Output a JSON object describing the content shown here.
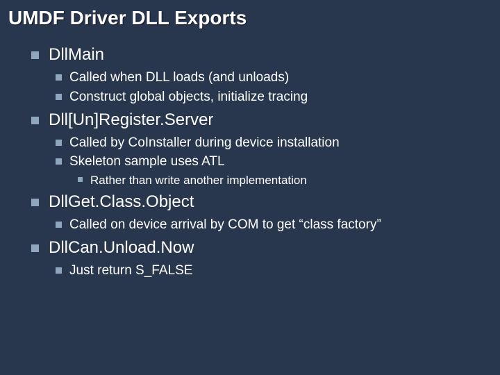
{
  "title": "UMDF Driver DLL Exports",
  "items": [
    {
      "label": "DllMain",
      "children": [
        {
          "label": "Called when DLL loads (and unloads)"
        },
        {
          "label": "Construct global objects, initialize tracing"
        }
      ]
    },
    {
      "label": "Dll[Un]Register.Server",
      "children": [
        {
          "label": "Called by CoInstaller during device installation"
        },
        {
          "label": "Skeleton sample uses ATL",
          "children": [
            {
              "label": "Rather than write another implementation"
            }
          ]
        }
      ]
    },
    {
      "label": "DllGet.Class.Object",
      "children": [
        {
          "label": "Called on device arrival by COM to get “class factory”"
        }
      ]
    },
    {
      "label": "DllCan.Unload.Now",
      "children": [
        {
          "label": "Just return S_FALSE"
        }
      ]
    }
  ]
}
